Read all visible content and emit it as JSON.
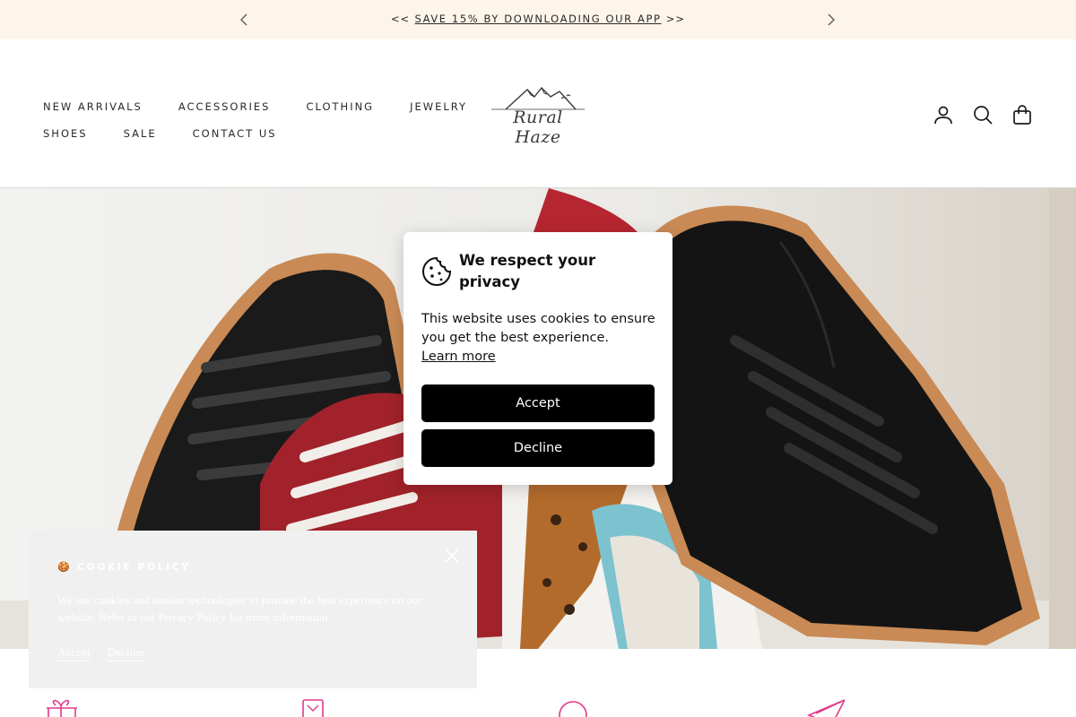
{
  "announcement": {
    "prefix": "<<",
    "link": "SAVE 15% BY DOWNLOADING OUR APP",
    "suffix": ">>",
    "prev_icon": "chevron-left-icon",
    "next_icon": "chevron-right-icon"
  },
  "header": {
    "nav_row1": [
      "NEW ARRIVALS",
      "ACCESSORIES",
      "CLOTHING",
      "JEWELRY"
    ],
    "nav_row2": [
      "SHOES",
      "SALE",
      "CONTACT US"
    ],
    "logo_text": "Rural Haze",
    "icons": [
      "account-icon",
      "search-icon",
      "cart-icon"
    ]
  },
  "privacy_modal": {
    "title": "We respect your privacy",
    "body": "This website uses cookies to ensure you get the best experience.",
    "learn_more": "Learn more",
    "accept": "Accept",
    "decline": "Decline",
    "icon": "cookie-icon"
  },
  "cookie_policy": {
    "emoji": "🍪",
    "title": "COOKIE POLICY",
    "text": "We use cookies and similar technologies to provide the best experience on our website. Refer to our Privacy Policy for more information.",
    "accept": "Accept",
    "decline": "Decline",
    "close_icon": "close-icon"
  },
  "features": [
    "gift-icon",
    "badge-icon",
    "chat-icon",
    "paper-plane-icon"
  ],
  "colors": {
    "announcement_bg": "#fdf5ea",
    "feature_icon": "#e0398c",
    "button_bg": "#000000"
  }
}
